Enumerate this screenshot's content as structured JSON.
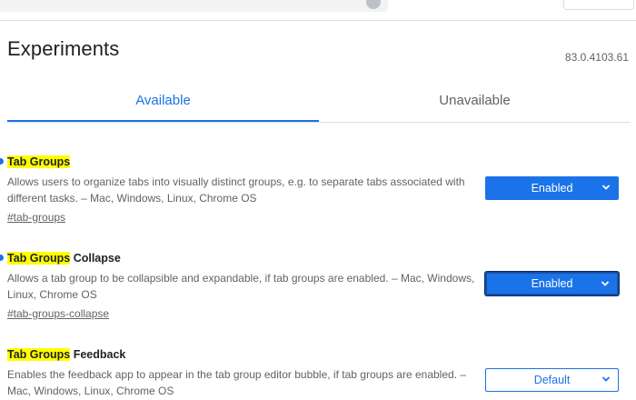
{
  "header": {
    "title": "Experiments",
    "version": "83.0.4103.61"
  },
  "tabs": [
    {
      "label": "Available",
      "active": true
    },
    {
      "label": "Unavailable",
      "active": false
    }
  ],
  "experiments": [
    {
      "title_highlight": "Tab Groups",
      "title_rest": "",
      "description": "Allows users to organize tabs into visually distinct groups, e.g. to separate tabs associated with different tasks. – Mac, Windows, Linux, Chrome OS",
      "link": "#tab-groups",
      "value": "Enabled"
    },
    {
      "title_highlight": "Tab Groups",
      "title_rest": " Collapse",
      "description": "Allows a tab group to be collapsible and expandable, if tab groups are enabled. – Mac, Windows, Linux, Chrome OS",
      "link": "#tab-groups-collapse",
      "value": "Enabled"
    },
    {
      "title_highlight": "Tab Groups",
      "title_rest": " Feedback",
      "description": "Enables the feedback app to appear in the tab group editor bubble, if tab groups are enabled. – Mac, Windows, Linux, Chrome OS",
      "link": "",
      "value": "Default"
    }
  ],
  "colors": {
    "accent": "#1a73e8",
    "highlight": "#ffff00",
    "text_secondary": "#5f6368"
  }
}
